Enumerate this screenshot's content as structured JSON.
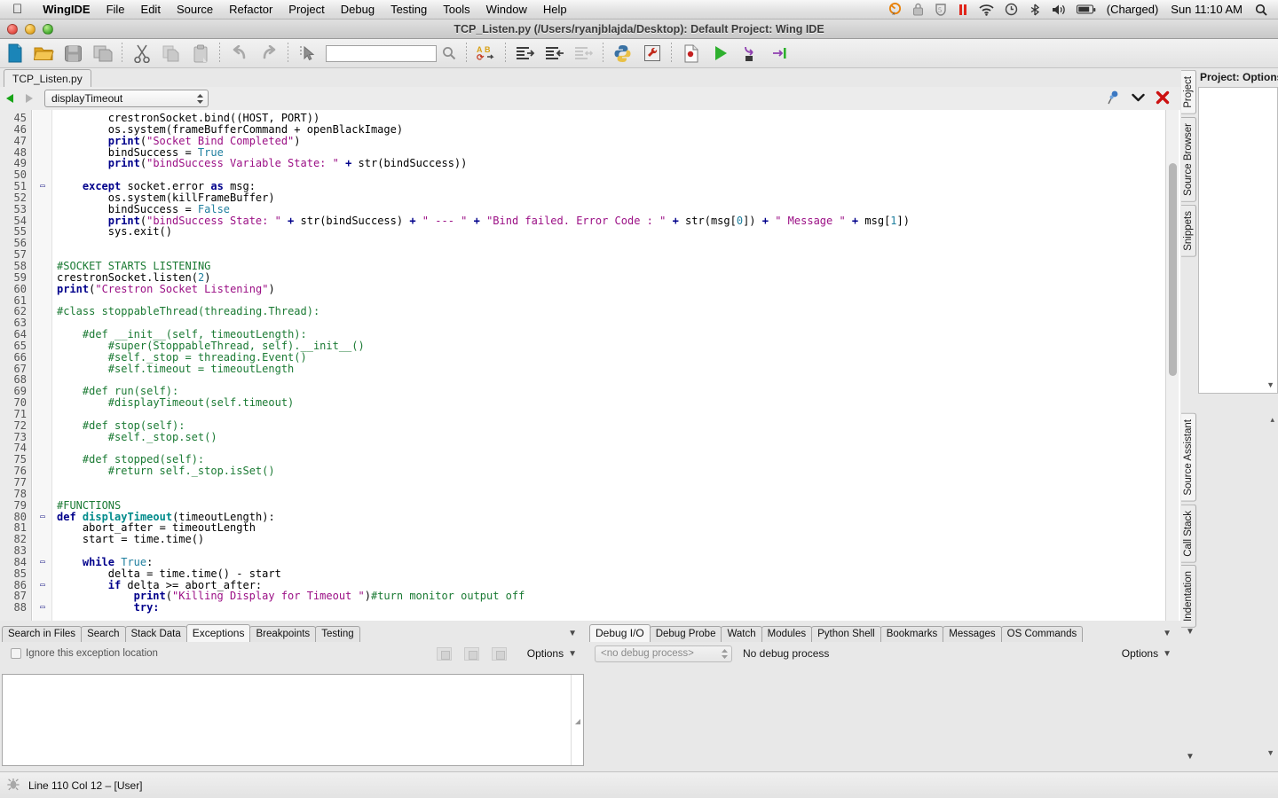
{
  "menubar": {
    "apple": "apple-logo",
    "items": [
      "WingIDE",
      "File",
      "Edit",
      "Source",
      "Refactor",
      "Project",
      "Debug",
      "Testing",
      "Tools",
      "Window",
      "Help"
    ],
    "status_icons": [
      "crashplan-icon",
      "lock-icon",
      "shield-icon",
      "pause-icon",
      "wifi-icon",
      "timemachine-icon",
      "bluetooth-icon",
      "volume-icon",
      "battery-icon"
    ],
    "battery_label": "(Charged)",
    "clock": "Sun 11:10 AM",
    "search_icon": "spotlight-search-icon"
  },
  "window": {
    "title": "TCP_Listen.py (/Users/ryanjblajda/Desktop): Default Project: Wing IDE"
  },
  "toolbar": {
    "buttons": [
      {
        "name": "new-file-button",
        "icon": "new-file-icon"
      },
      {
        "name": "open-file-button",
        "icon": "open-folder-icon"
      },
      {
        "name": "save-button",
        "icon": "save-disk-icon"
      },
      {
        "name": "save-all-button",
        "icon": "save-all-icon"
      },
      {
        "name": "cut-button",
        "icon": "scissors-icon"
      },
      {
        "name": "copy-button",
        "icon": "copy-icon"
      },
      {
        "name": "paste-button",
        "icon": "paste-icon"
      },
      {
        "name": "undo-button",
        "icon": "undo-arrow-icon"
      },
      {
        "name": "redo-button",
        "icon": "redo-arrow-icon"
      },
      {
        "name": "select-tool-button",
        "icon": "cursor-arrow-icon"
      },
      {
        "name": "find-button",
        "icon": "magnifier-icon"
      },
      {
        "name": "replace-button",
        "icon": "abc-replace-icon"
      },
      {
        "name": "indent-button",
        "icon": "indent-right-icon"
      },
      {
        "name": "outdent-button",
        "icon": "indent-left-icon"
      },
      {
        "name": "indent-toggle-button",
        "icon": "indent-both-icon"
      },
      {
        "name": "python-shell-button",
        "icon": "python-logo-icon"
      },
      {
        "name": "project-properties-button",
        "icon": "wrench-icon"
      },
      {
        "name": "breakpoint-button",
        "icon": "breakpoint-file-icon"
      },
      {
        "name": "run-button",
        "icon": "green-play-icon"
      },
      {
        "name": "step-over-button",
        "icon": "step-over-icon"
      },
      {
        "name": "step-into-button",
        "icon": "step-into-icon"
      }
    ],
    "search_placeholder": "",
    "search_value": ""
  },
  "editor": {
    "tab_label": "TCP_Listen.py",
    "nav": {
      "back_icon": "back-triangle-icon",
      "forward_icon": "forward-triangle-icon",
      "symbol_value": "displayTimeout",
      "pin_icon": "pin-icon",
      "chevron_icon": "chevron-down-icon",
      "close_icon": "red-x-close-icon"
    },
    "code": [
      {
        "n": 45,
        "fold": "",
        "indent": 8,
        "tokens": [
          {
            "t": "crestronSocket.bind((HOST, PORT))",
            "c": "pl"
          }
        ]
      },
      {
        "n": 46,
        "fold": "",
        "indent": 8,
        "tokens": [
          {
            "t": "os.system(frameBufferCommand + openBlackImage)",
            "c": "pl"
          }
        ]
      },
      {
        "n": 47,
        "fold": "",
        "indent": 8,
        "tokens": [
          {
            "t": "print",
            "c": "op"
          },
          {
            "t": "(",
            "c": "pl"
          },
          {
            "t": "\"Socket Bind Completed\"",
            "c": "str"
          },
          {
            "t": ")",
            "c": "pl"
          }
        ]
      },
      {
        "n": 48,
        "fold": "",
        "indent": 8,
        "tokens": [
          {
            "t": "bindSuccess = ",
            "c": "pl"
          },
          {
            "t": "True",
            "c": "bn"
          }
        ]
      },
      {
        "n": 49,
        "fold": "",
        "indent": 8,
        "tokens": [
          {
            "t": "print",
            "c": "op"
          },
          {
            "t": "(",
            "c": "pl"
          },
          {
            "t": "\"bindSuccess Variable State: \"",
            "c": "str"
          },
          {
            "t": " + ",
            "c": "op"
          },
          {
            "t": "str(bindSuccess))",
            "c": "pl"
          }
        ]
      },
      {
        "n": 50,
        "fold": "",
        "indent": 0,
        "tokens": []
      },
      {
        "n": 51,
        "fold": "-",
        "indent": 4,
        "tokens": [
          {
            "t": "except",
            "c": "kw"
          },
          {
            "t": " socket.error ",
            "c": "pl"
          },
          {
            "t": "as",
            "c": "kw"
          },
          {
            "t": " msg:",
            "c": "pl"
          }
        ]
      },
      {
        "n": 52,
        "fold": "",
        "indent": 8,
        "tokens": [
          {
            "t": "os.system(killFrameBuffer)",
            "c": "pl"
          }
        ]
      },
      {
        "n": 53,
        "fold": "",
        "indent": 8,
        "tokens": [
          {
            "t": "bindSuccess = ",
            "c": "pl"
          },
          {
            "t": "False",
            "c": "bn"
          }
        ]
      },
      {
        "n": 54,
        "fold": "",
        "indent": 8,
        "tokens": [
          {
            "t": "print",
            "c": "op"
          },
          {
            "t": "(",
            "c": "pl"
          },
          {
            "t": "\"bindSuccess State: \"",
            "c": "str"
          },
          {
            "t": " + ",
            "c": "op"
          },
          {
            "t": "str(bindSuccess)",
            "c": "pl"
          },
          {
            "t": " + ",
            "c": "op"
          },
          {
            "t": "\" --- \"",
            "c": "str"
          },
          {
            "t": " + ",
            "c": "op"
          },
          {
            "t": "\"Bind failed. Error Code : \"",
            "c": "str"
          },
          {
            "t": " + ",
            "c": "op"
          },
          {
            "t": "str(msg[",
            "c": "pl"
          },
          {
            "t": "0",
            "c": "num"
          },
          {
            "t": "])",
            "c": "pl"
          },
          {
            "t": " + ",
            "c": "op"
          },
          {
            "t": "\" Message \"",
            "c": "str"
          },
          {
            "t": " + ",
            "c": "op"
          },
          {
            "t": "msg[",
            "c": "pl"
          },
          {
            "t": "1",
            "c": "num"
          },
          {
            "t": "])",
            "c": "pl"
          }
        ]
      },
      {
        "n": 55,
        "fold": "",
        "indent": 8,
        "tokens": [
          {
            "t": "sys.exit()",
            "c": "pl"
          }
        ]
      },
      {
        "n": 56,
        "fold": "",
        "indent": 0,
        "tokens": []
      },
      {
        "n": 57,
        "fold": "",
        "indent": 0,
        "tokens": []
      },
      {
        "n": 58,
        "fold": "",
        "indent": 0,
        "tokens": [
          {
            "t": "#SOCKET STARTS LISTENING",
            "c": "cm"
          }
        ]
      },
      {
        "n": 59,
        "fold": "",
        "indent": 0,
        "tokens": [
          {
            "t": "crestronSocket.listen(",
            "c": "pl"
          },
          {
            "t": "2",
            "c": "num"
          },
          {
            "t": ")",
            "c": "pl"
          }
        ]
      },
      {
        "n": 60,
        "fold": "",
        "indent": 0,
        "tokens": [
          {
            "t": "print",
            "c": "op"
          },
          {
            "t": "(",
            "c": "pl"
          },
          {
            "t": "\"Crestron Socket Listening\"",
            "c": "str"
          },
          {
            "t": ")",
            "c": "pl"
          }
        ]
      },
      {
        "n": 61,
        "fold": "",
        "indent": 0,
        "tokens": []
      },
      {
        "n": 62,
        "fold": "",
        "indent": 0,
        "tokens": [
          {
            "t": "#class stoppableThread(threading.Thread):",
            "c": "cm"
          }
        ]
      },
      {
        "n": 63,
        "fold": "",
        "indent": 0,
        "tokens": []
      },
      {
        "n": 64,
        "fold": "",
        "indent": 4,
        "tokens": [
          {
            "t": "#def __init__(self, timeoutLength):",
            "c": "cm"
          }
        ]
      },
      {
        "n": 65,
        "fold": "",
        "indent": 8,
        "tokens": [
          {
            "t": "#super(StoppableThread, self).__init__()",
            "c": "cm"
          }
        ]
      },
      {
        "n": 66,
        "fold": "",
        "indent": 8,
        "tokens": [
          {
            "t": "#self._stop = threading.Event()",
            "c": "cm"
          }
        ]
      },
      {
        "n": 67,
        "fold": "",
        "indent": 8,
        "tokens": [
          {
            "t": "#self.timeout = timeoutLength",
            "c": "cm"
          }
        ]
      },
      {
        "n": 68,
        "fold": "",
        "indent": 0,
        "tokens": []
      },
      {
        "n": 69,
        "fold": "",
        "indent": 4,
        "tokens": [
          {
            "t": "#def run(self):",
            "c": "cm"
          }
        ]
      },
      {
        "n": 70,
        "fold": "",
        "indent": 8,
        "tokens": [
          {
            "t": "#displayTimeout(self.timeout)",
            "c": "cm"
          }
        ]
      },
      {
        "n": 71,
        "fold": "",
        "indent": 0,
        "tokens": []
      },
      {
        "n": 72,
        "fold": "",
        "indent": 4,
        "tokens": [
          {
            "t": "#def stop(self):",
            "c": "cm"
          }
        ]
      },
      {
        "n": 73,
        "fold": "",
        "indent": 8,
        "tokens": [
          {
            "t": "#self._stop.set()",
            "c": "cm"
          }
        ]
      },
      {
        "n": 74,
        "fold": "",
        "indent": 0,
        "tokens": []
      },
      {
        "n": 75,
        "fold": "",
        "indent": 4,
        "tokens": [
          {
            "t": "#def stopped(self):",
            "c": "cm"
          }
        ]
      },
      {
        "n": 76,
        "fold": "",
        "indent": 8,
        "tokens": [
          {
            "t": "#return self._stop.isSet()",
            "c": "cm"
          }
        ]
      },
      {
        "n": 77,
        "fold": "",
        "indent": 0,
        "tokens": []
      },
      {
        "n": 78,
        "fold": "",
        "indent": 0,
        "tokens": []
      },
      {
        "n": 79,
        "fold": "",
        "indent": 0,
        "tokens": [
          {
            "t": "#FUNCTIONS",
            "c": "cm"
          }
        ]
      },
      {
        "n": 80,
        "fold": "-",
        "indent": 0,
        "tokens": [
          {
            "t": "def",
            "c": "kw"
          },
          {
            "t": " ",
            "c": "pl"
          },
          {
            "t": "displayTimeout",
            "c": "fn"
          },
          {
            "t": "(timeoutLength):",
            "c": "pl"
          }
        ]
      },
      {
        "n": 81,
        "fold": "",
        "indent": 4,
        "tokens": [
          {
            "t": "abort_after = timeoutLength",
            "c": "pl"
          }
        ]
      },
      {
        "n": 82,
        "fold": "",
        "indent": 4,
        "tokens": [
          {
            "t": "start = time.time()",
            "c": "pl"
          }
        ]
      },
      {
        "n": 83,
        "fold": "",
        "indent": 0,
        "tokens": []
      },
      {
        "n": 84,
        "fold": "-",
        "indent": 4,
        "tokens": [
          {
            "t": "while",
            "c": "kw"
          },
          {
            "t": " ",
            "c": "pl"
          },
          {
            "t": "True",
            "c": "bn"
          },
          {
            "t": ":",
            "c": "pl"
          }
        ]
      },
      {
        "n": 85,
        "fold": "",
        "indent": 8,
        "tokens": [
          {
            "t": "delta = time.time() - start",
            "c": "pl"
          }
        ]
      },
      {
        "n": 86,
        "fold": "-",
        "indent": 8,
        "tokens": [
          {
            "t": "if",
            "c": "kw"
          },
          {
            "t": " delta >= abort_after:",
            "c": "pl"
          }
        ]
      },
      {
        "n": 87,
        "fold": "",
        "indent": 12,
        "tokens": [
          {
            "t": "print",
            "c": "op"
          },
          {
            "t": "(",
            "c": "pl"
          },
          {
            "t": "\"Killing Display for Timeout \"",
            "c": "str"
          },
          {
            "t": ")",
            "c": "pl"
          },
          {
            "t": "#turn monitor output off",
            "c": "cm"
          }
        ]
      },
      {
        "n": 88,
        "fold": "-",
        "indent": 12,
        "tokens": [
          {
            "t": "try:",
            "c": "kw"
          }
        ]
      }
    ]
  },
  "right_tabs_top": [
    {
      "label": "Project",
      "active": true
    },
    {
      "label": "Source Browser",
      "active": false
    },
    {
      "label": "Snippets",
      "active": false
    }
  ],
  "right_tabs_bottom": [
    {
      "label": "Source Assistant",
      "active": true
    },
    {
      "label": "Call Stack",
      "active": false
    },
    {
      "label": "Indentation",
      "active": false
    }
  ],
  "right_panel": {
    "title": "Project: Options",
    "scroll_arrow_icon": "resize-grip-icon"
  },
  "bottom_left": {
    "tabs": [
      {
        "label": "Search in Files",
        "active": false
      },
      {
        "label": "Search",
        "active": false
      },
      {
        "label": "Stack Data",
        "active": false
      },
      {
        "label": "Exceptions",
        "active": true
      },
      {
        "label": "Breakpoints",
        "active": false
      },
      {
        "label": "Testing",
        "active": false
      }
    ],
    "panel_collapse_icon": "chevron-down-icon",
    "checkbox_label": "Ignore this exception location",
    "checkbox_checked": false,
    "tool_icons": [
      "exception-up-icon",
      "exception-middle-icon",
      "exception-down-icon"
    ],
    "options_label": "Options",
    "options_arrow": "chevron-down-icon"
  },
  "bottom_right": {
    "tabs": [
      {
        "label": "Debug I/O",
        "active": true
      },
      {
        "label": "Debug Probe",
        "active": false
      },
      {
        "label": "Watch",
        "active": false
      },
      {
        "label": "Modules",
        "active": false
      },
      {
        "label": "Python Shell",
        "active": false
      },
      {
        "label": "Bookmarks",
        "active": false
      },
      {
        "label": "Messages",
        "active": false
      },
      {
        "label": "OS Commands",
        "active": false
      }
    ],
    "panel_collapse_icon": "chevron-down-icon",
    "process_select_value": "<no debug process>",
    "process_status": "No debug process",
    "options_label": "Options",
    "options_arrow": "chevron-down-icon"
  },
  "statusbar": {
    "icon": "bug-icon",
    "text": "Line 110 Col 12 – [User]"
  }
}
